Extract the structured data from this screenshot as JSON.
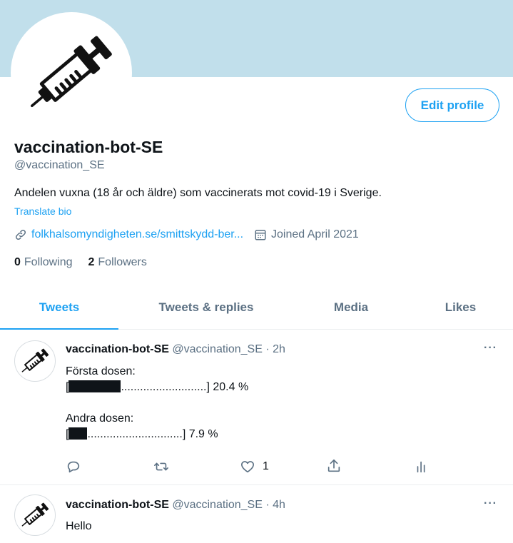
{
  "profile": {
    "display_name": "vaccination-bot-SE",
    "handle": "@vaccination_SE",
    "bio": "Andelen vuxna (18 år och äldre) som vaccinerats mot covid-19 i Sverige.",
    "translate_label": "Translate bio",
    "link": "folkhalsomyndigheten.se/smittskydd-ber...",
    "joined": "Joined April 2021",
    "following_count": "0",
    "following_label": "Following",
    "followers_count": "2",
    "followers_label": "Followers",
    "edit_label": "Edit profile",
    "banner_color": "#c1dfeb",
    "accent_color": "#1da1f2"
  },
  "tabs": [
    {
      "label": "Tweets",
      "active": true
    },
    {
      "label": "Tweets & replies",
      "active": false
    },
    {
      "label": "Media",
      "active": false
    },
    {
      "label": "Likes",
      "active": false
    }
  ],
  "tweets": [
    {
      "name": "vaccination-bot-SE",
      "handle_time": "@vaccination_SE · 2h",
      "more": "···",
      "lines": {
        "first_label": "Första dosen:",
        "first_open": "[",
        "first_dots": "...........................",
        "first_close": "] 20.4 %",
        "first_progress": 0.204,
        "second_label": "Andra dosen:",
        "second_open": "[",
        "second_dots": "..............................",
        "second_close": "] 7.9 %",
        "second_progress": 0.079
      },
      "like_count": "1",
      "icons": [
        "reply-icon",
        "retweet-icon",
        "like-icon",
        "share-icon",
        "analytics-icon"
      ]
    },
    {
      "name": "vaccination-bot-SE",
      "handle_time": "@vaccination_SE · 4h",
      "more": "···",
      "text": "Hello"
    }
  ]
}
